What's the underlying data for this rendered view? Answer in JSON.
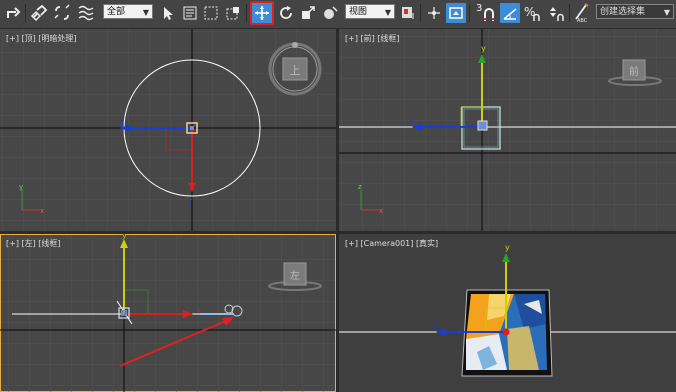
{
  "toolbar": {
    "filter_select": "全部",
    "coord_select": "视图",
    "snap_number": "3",
    "selection_set_placeholder": "创建选择集"
  },
  "viewports": {
    "top": {
      "label": "[+] [顶] [明暗处理]",
      "cube_label": "上"
    },
    "front": {
      "label": "[+] [前] [线框]",
      "cube_label": "前"
    },
    "left": {
      "label": "[+] [左] [线框]",
      "cube_label": "左"
    },
    "camera": {
      "label": "[+] [Camera001] [真实]"
    }
  },
  "axis_labels": {
    "x": "x",
    "y": "y",
    "z": "z"
  },
  "colors": {
    "active_border": "#e8b04a",
    "axis_x": "#d82020",
    "axis_y": "#c8d010",
    "axis_z": "#1c3cd8",
    "tool_active": "#3d8cd7",
    "highlight_red": "#e02020"
  }
}
